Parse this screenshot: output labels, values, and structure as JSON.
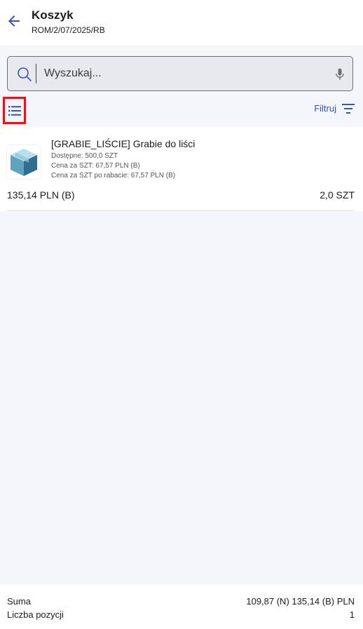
{
  "header": {
    "title": "Koszyk",
    "subtitle": "ROM/2/07/2025/RB"
  },
  "search": {
    "placeholder": "Wyszukaj..."
  },
  "toolbar": {
    "filter_label": "Filtruj"
  },
  "products": [
    {
      "name": "[GRABIE_LIŚCIE] Grabie do liści",
      "available": "Dostępne: 500,0 SZT",
      "price": "Cena za SZT: 67,57 PLN (B)",
      "price_discount": "Cena za SZT po rabacie: 67,57 PLN (B)",
      "total": "135,14 PLN (B)",
      "quantity": "2,0 SZT",
      "icon": "box-icon"
    }
  ],
  "footer": {
    "sum_label": "Suma",
    "sum_value": "109,87 (N) 135,14 (B) PLN",
    "count_label": "Liczba pozycji",
    "count_value": "1"
  },
  "colors": {
    "accent": "#3451c9",
    "highlight": "#e0151d",
    "background": "#f5f6fb"
  }
}
